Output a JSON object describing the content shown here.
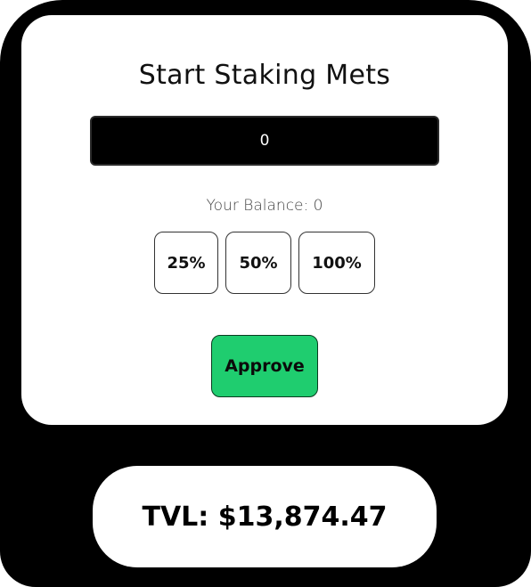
{
  "stake": {
    "title": "Start Staking Mets",
    "amount_value": "0",
    "balance_text": "Your Balance: 0",
    "percent_buttons": [
      {
        "label": "25%"
      },
      {
        "label": "50%"
      },
      {
        "label": "100%"
      }
    ],
    "approve_label": "Approve"
  },
  "tvl": {
    "text": "TVL: $13,874.47"
  },
  "colors": {
    "frame": "#000000",
    "card": "#ffffff",
    "input_bg": "#000000",
    "approve_bg": "#1fcd6f"
  }
}
